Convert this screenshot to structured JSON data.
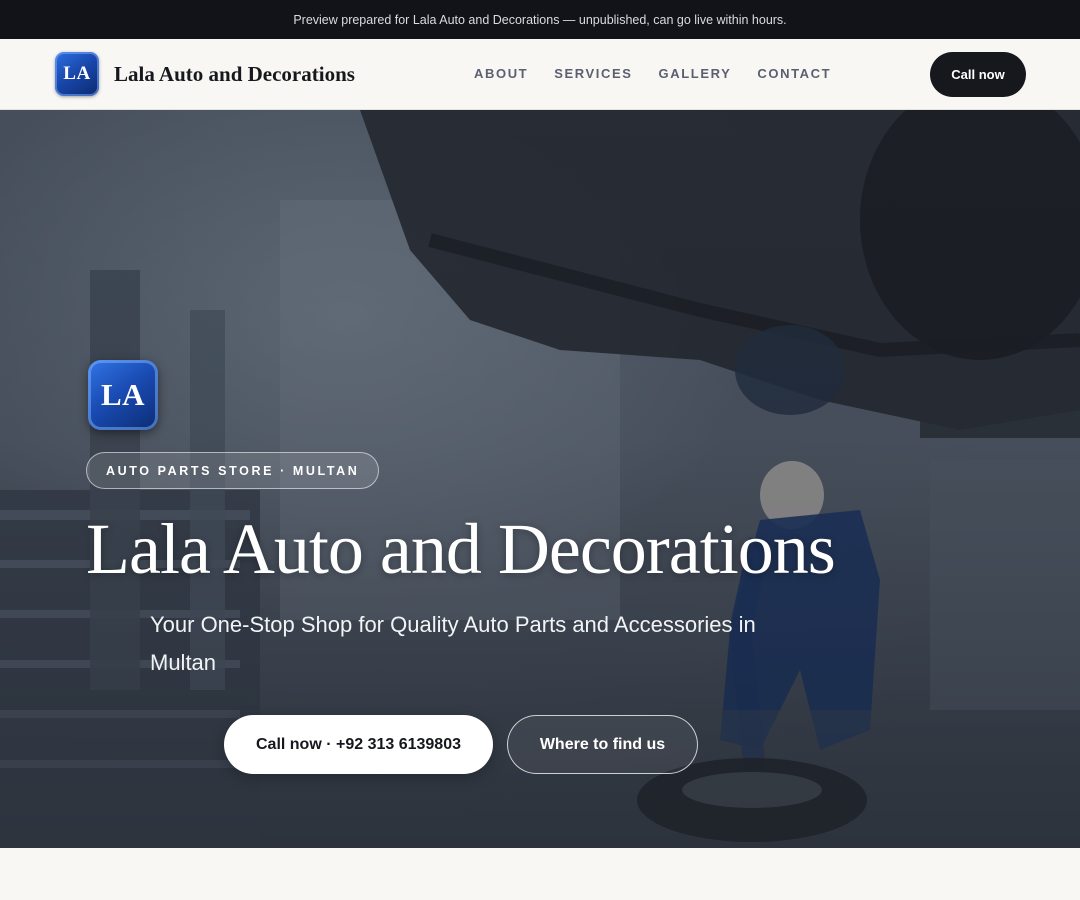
{
  "preview_notice": "Preview prepared for Lala Auto and Decorations — unpublished, can go live within hours.",
  "header": {
    "logo_text": "LA",
    "brand_name": "Lala Auto and Decorations",
    "nav": [
      "ABOUT",
      "SERVICES",
      "GALLERY",
      "CONTACT"
    ],
    "cta_label": "Call now"
  },
  "hero": {
    "logo_text": "LA",
    "eyebrow": "AUTO PARTS STORE · MULTAN",
    "title": "Lala Auto and Decorations",
    "subtitle": "Your One-Stop Shop for Quality Auto Parts and Accessories in Multan",
    "primary_button": "Call now · +92 313 6139803",
    "secondary_button": "Where to find us",
    "background_image": "mechanic-working-under-lifted-car-photo"
  },
  "colors": {
    "dark": "#16181d",
    "preview_bar": "#111318",
    "page_background": "#f8f7f4",
    "logo_blue": "#1a4cb4"
  }
}
